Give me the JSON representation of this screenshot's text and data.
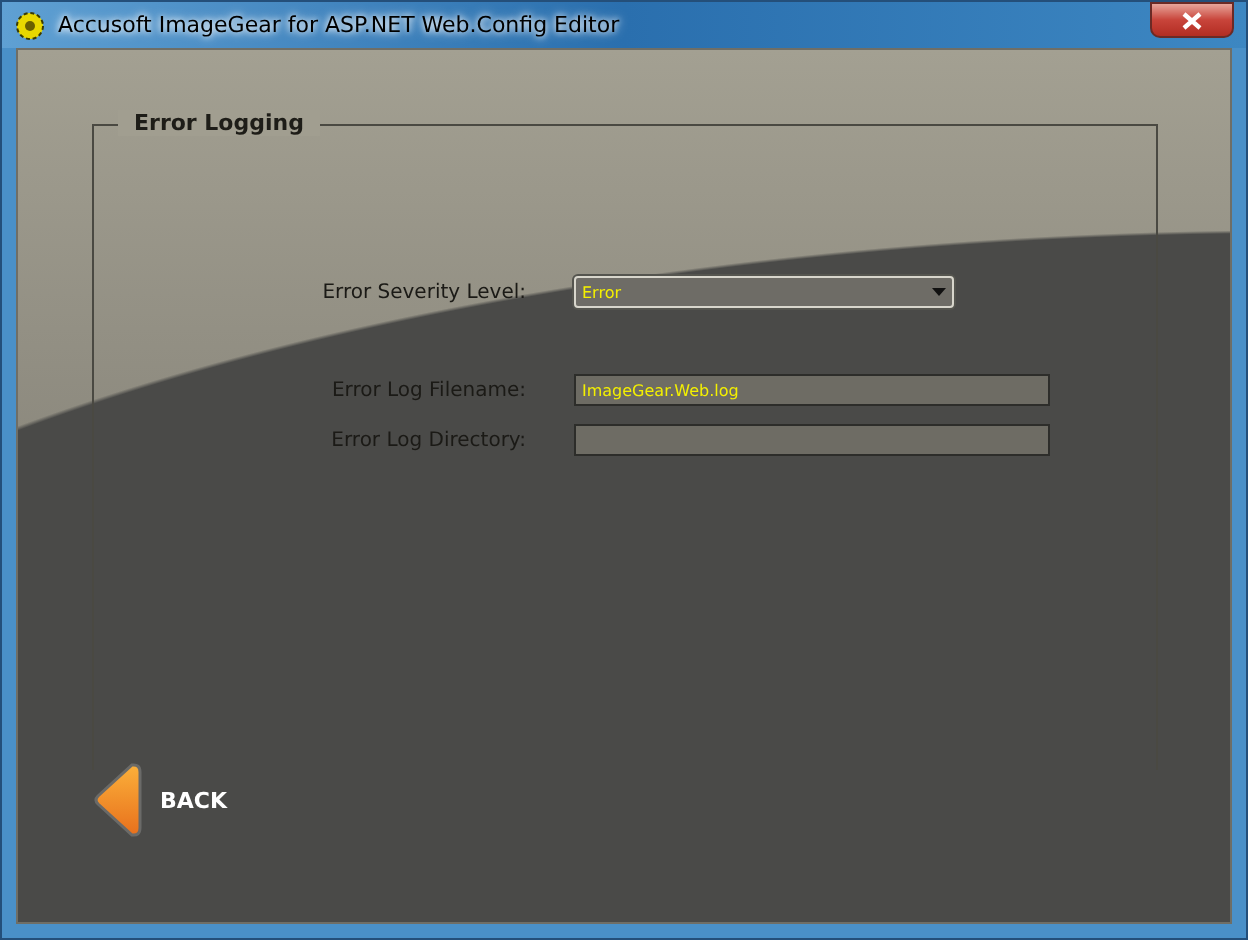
{
  "window": {
    "title": "Accusoft ImageGear for ASP.NET Web.Config Editor"
  },
  "group": {
    "title": "Error Logging"
  },
  "fields": [
    {
      "kind": "dropdown",
      "label": "Error Severity Level:",
      "value": "Error"
    },
    {
      "kind": "text",
      "label": "Error Log Filename:",
      "value": "ImageGear.Web.log"
    },
    {
      "kind": "text",
      "label": "Error Log Directory:"
    }
  ],
  "back_button": {
    "label": "BACK"
  }
}
